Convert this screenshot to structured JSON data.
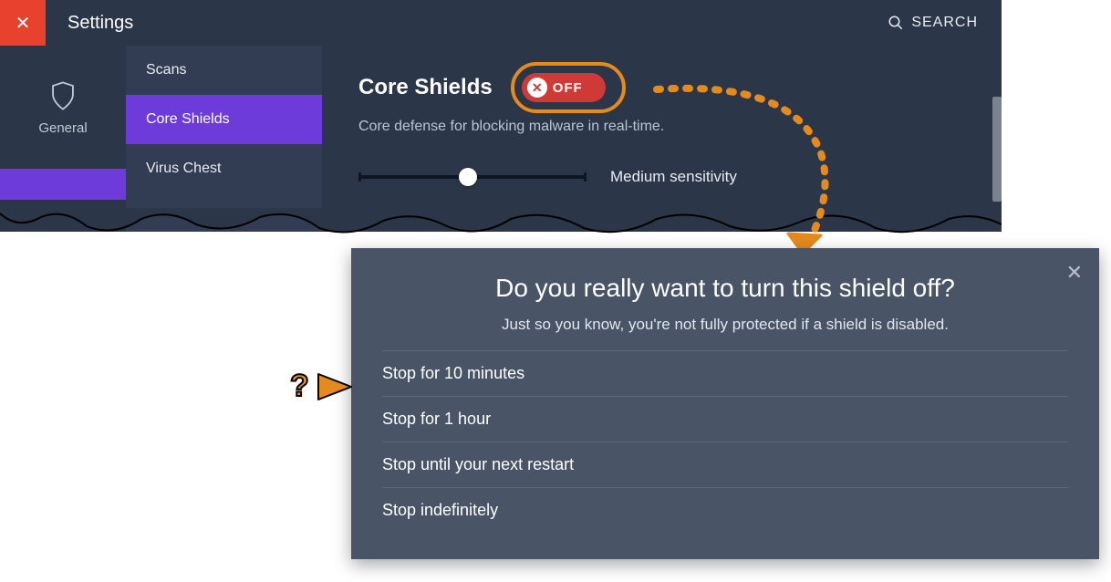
{
  "titlebar": {
    "title": "Settings",
    "search_label": "SEARCH"
  },
  "left_rail": {
    "items": [
      {
        "label": "General"
      }
    ]
  },
  "sub_sidebar": {
    "items": [
      {
        "label": "Scans",
        "selected": false
      },
      {
        "label": "Core Shields",
        "selected": true
      },
      {
        "label": "Virus Chest",
        "selected": false
      }
    ]
  },
  "content": {
    "section_title": "Core Shields",
    "toggle": {
      "state": "OFF"
    },
    "description": "Core defense for blocking malware in real-time.",
    "slider_label": "Medium sensitivity"
  },
  "dialog": {
    "title": "Do you really want to turn this shield off?",
    "subtitle": "Just so you know, you're not fully protected if a shield is disabled.",
    "options": [
      "Stop for 10 minutes",
      "Stop for 1 hour",
      "Stop until your next restart",
      "Stop indefinitely"
    ]
  },
  "annotations": {
    "callout_color": "#e58b1d",
    "question_mark": "?"
  }
}
